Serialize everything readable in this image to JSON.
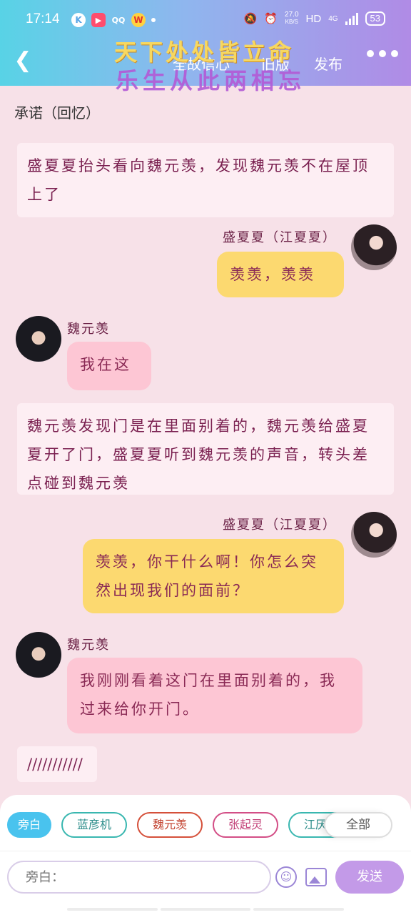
{
  "status_bar": {
    "time": "17:14",
    "app_icons": [
      "K",
      "▶",
      "QQ",
      "W"
    ],
    "net_speed": "27.0",
    "net_unit": "KB/S",
    "hd": "HD",
    "network": "4G",
    "battery": "53"
  },
  "nav": {
    "back_icon": "chevron-left-icon",
    "tab_1": "全故信心",
    "tab_2": "旧版",
    "tab_3": "发布",
    "banner_line1": "天下处处皆立命",
    "banner_line2": "乐生从此两相忘"
  },
  "chapter": {
    "title": "承诺（回忆）"
  },
  "messages": {
    "narration_1": "盛夏夏抬头看向魏元羡，发现魏元羡不在屋顶上了",
    "speaker_1": "盛夏夏（江夏夏）",
    "bubble_1": "羡羡，羡羡",
    "speaker_2": "魏元羡",
    "bubble_2": "我在这",
    "narration_2": "魏元羡发现门是在里面别着的，魏元羡给盛夏夏开了门，盛夏夏听到魏元羡的声音，转头差点碰到魏元羡",
    "speaker_3": "盛夏夏（江夏夏）",
    "bubble_3": "羡羡，你干什么啊！你怎么突然出现我们的面前？",
    "speaker_4": "魏元羡",
    "bubble_4": "我刚刚看着这门在里面别着的，我过来给你开门。",
    "narration_3": "///////////"
  },
  "composer": {
    "chips": [
      "旁白",
      "蓝彦机",
      "魏元羡",
      "张起灵",
      "江厌离"
    ],
    "all_label": "全部",
    "input_placeholder": "旁白：",
    "send_label": "发送"
  },
  "colors": {
    "header_start": "#58d3e6",
    "header_end": "#b08be6",
    "page_bg": "#f7e1e8",
    "bubble_yellow": "#fcd970",
    "bubble_pink": "#fdc6d4",
    "send_button": "#c39ae8"
  }
}
